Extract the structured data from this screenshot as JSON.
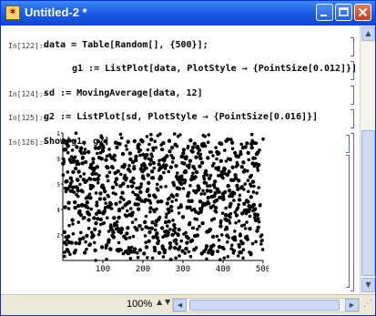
{
  "window": {
    "title": "Untitled-2 *"
  },
  "cells": [
    {
      "label": "In[122]:=",
      "code": "data = Table[Random[], {500}];"
    },
    {
      "label": "",
      "code": "g1 := ListPlot[data, PlotStyle → {PointSize[0.012]}]"
    },
    {
      "label": "In[124]:=",
      "code": "sd := MovingAverage[data, 12]"
    },
    {
      "label": "In[125]:=",
      "code": "g2 := ListPlot[sd, PlotStyle → {PointSize[0.016]}]"
    },
    {
      "label": "In[126]:=",
      "code": "Show[g1, g2]"
    }
  ],
  "statusbar": {
    "zoom": "100%",
    "zoom_up": "▲",
    "zoom_down": "▼"
  },
  "scroll": {
    "up": "▲",
    "down": "▼",
    "left": "◀",
    "right": "▶",
    "grip": "⋰"
  },
  "chart_data": {
    "type": "scatter",
    "title": "",
    "xlabel": "",
    "ylabel": "",
    "xlim": [
      0,
      500
    ],
    "ylim": [
      0,
      1
    ],
    "x_ticks": [
      "100",
      "200",
      "300",
      "400",
      "500"
    ],
    "y_ticks": [
      "0.2",
      "0.4",
      "0.6",
      "0.8",
      "1"
    ],
    "series": [
      {
        "count": 500,
        "point_size": 0.012,
        "color": "#000000"
      },
      {
        "count": 489,
        "point_size": 0.016,
        "color": "#000000"
      }
    ]
  }
}
